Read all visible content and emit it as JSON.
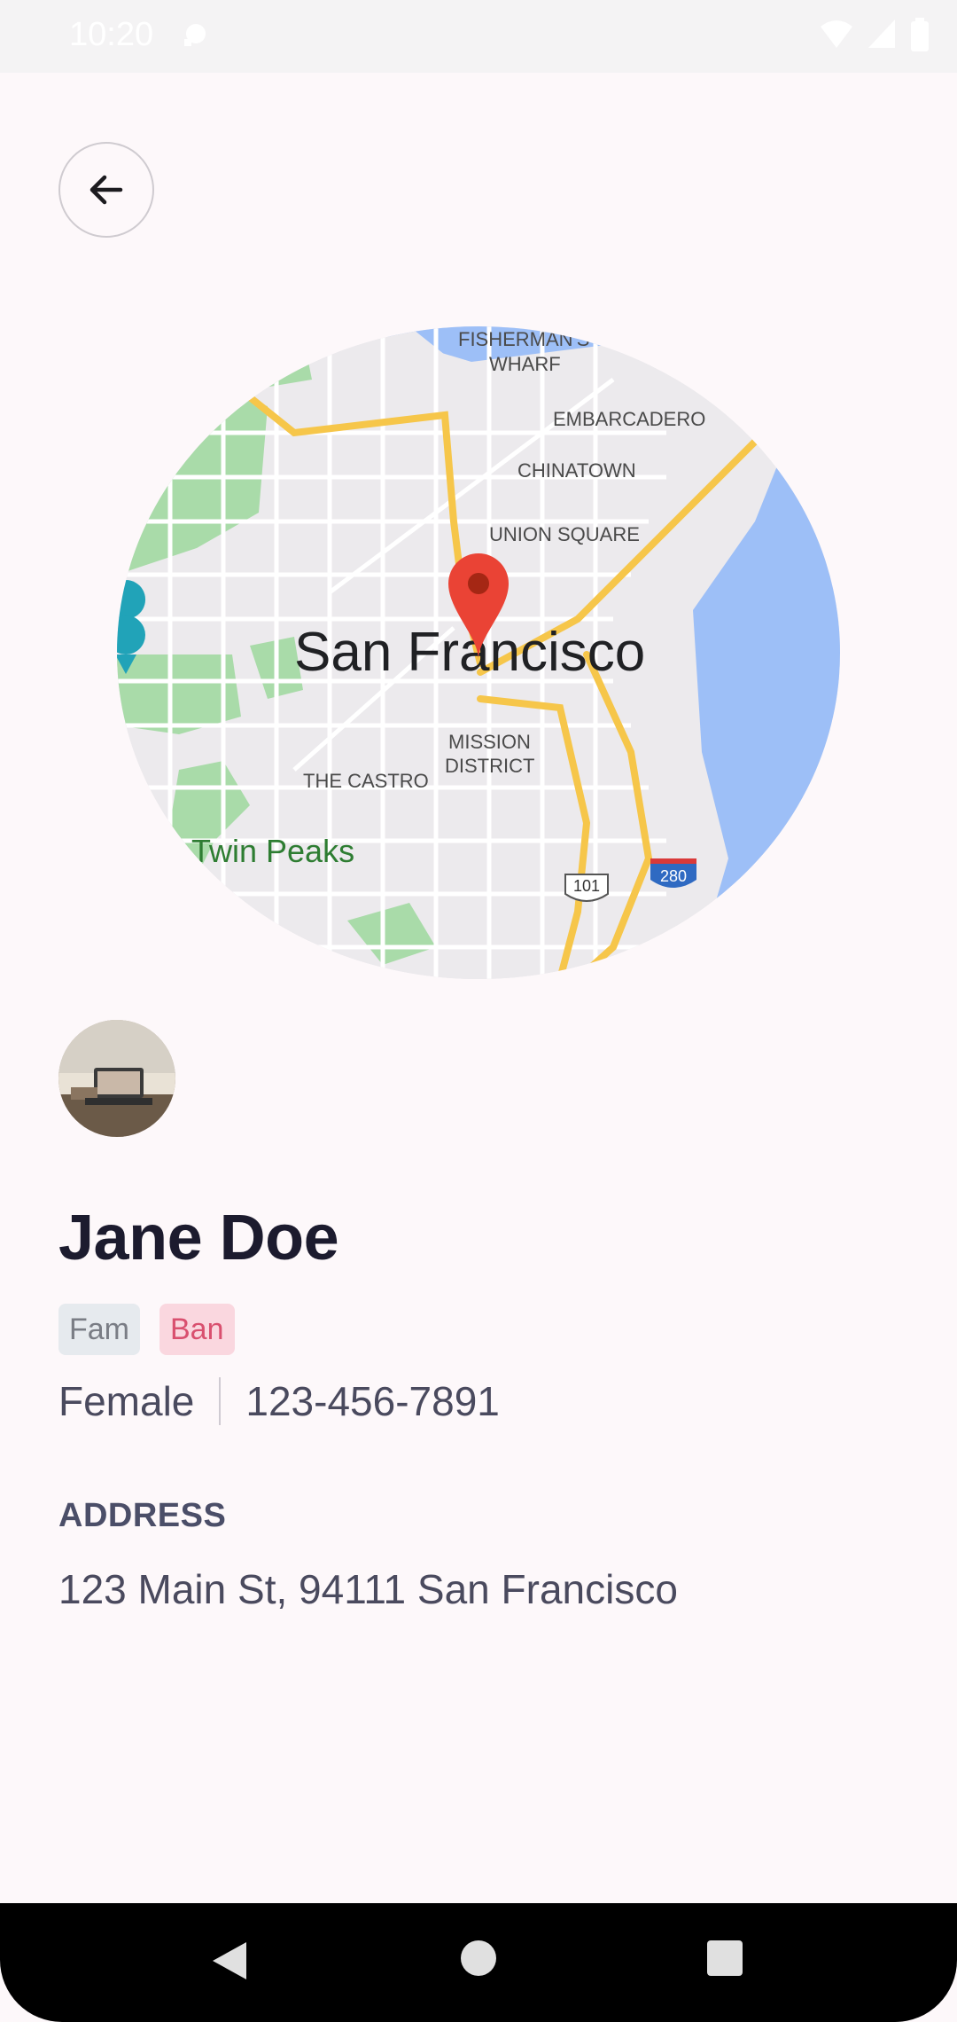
{
  "status_bar": {
    "time": "10:20",
    "icons": [
      "wifi-icon",
      "signal-icon",
      "battery-icon"
    ]
  },
  "header": {
    "back_icon": "arrow-left-icon"
  },
  "map": {
    "city_label": "San Francisco",
    "labels": {
      "fishermans_wharf_1": "FISHERMAN'S",
      "fishermans_wharf_2": "WHARF",
      "embarcadero": "EMBARCADERO",
      "chinatown": "CHINATOWN",
      "union_square": "UNION SQUARE",
      "mission_1": "MISSION",
      "mission_2": "DISTRICT",
      "castro": "THE CASTRO",
      "twin_peaks": "Twin Peaks",
      "hwy_101": "101",
      "hwy_280": "280"
    },
    "colors": {
      "water": "#9dbff7",
      "park": "#a9dba9",
      "highway": "#f6c64a",
      "pin": "#ea4335"
    }
  },
  "contact": {
    "name": "Jane Doe",
    "tags": [
      {
        "label": "Fam",
        "color": "#7a7d85",
        "bg": "#e6eaee"
      },
      {
        "label": "Ban",
        "color": "#d9506f",
        "bg": "#fad7df"
      }
    ],
    "gender": "Female",
    "phone": "123-456-7891",
    "address_label": "ADDRESS",
    "address": "123 Main St, 94111 San Francisco"
  },
  "nav_bar": {
    "buttons": [
      "back-nav-icon",
      "home-nav-icon",
      "recents-nav-icon"
    ]
  }
}
